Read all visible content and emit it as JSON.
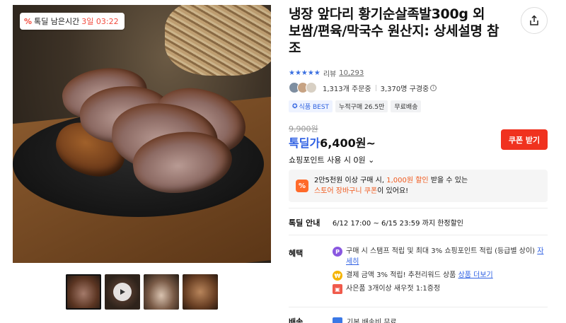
{
  "product": {
    "title": "냉장 앞다리 황기순살족발300g 외 보쌈/편육/막국수 원산지: 상세설명 참조",
    "deal_timer": {
      "label": "톡딜 남은시간",
      "time_left": "3일 03:22"
    },
    "thumbnail_count": 4,
    "active_thumbnail": 1
  },
  "rating": {
    "stars": 5,
    "review_label": "리뷰",
    "review_count": "10,293"
  },
  "buyers": {
    "orders": "1,313개 주문중",
    "subscribers": "3,370명 구경중"
  },
  "tags": [
    "식품 BEST",
    "누적구매 26.5만",
    "무료배송"
  ],
  "price": {
    "original": "9,900원",
    "deal_label": "톡딜가",
    "deal_price": "6,400원~",
    "coupon_button": "쿠폰 받기",
    "points_label": "쇼핑포인트 사용 시",
    "points_value": "0원"
  },
  "promo": {
    "icon": "%",
    "line1_a": "2만5천원 이상 구매 시, ",
    "line1_hl": "1,000원 할인",
    "line1_b": " 받을 수 있는",
    "line2_hl": "스토어 장바구니 쿠폰",
    "line2_b": "이 있어요!"
  },
  "deal_info": {
    "label": "톡딜 안내",
    "period": "6/12 17:00 ~ 6/15 23:59 까지 한정할인"
  },
  "benefits": {
    "label": "혜택",
    "items": [
      {
        "icon": "point-icon",
        "text": "구매 시 스탬프 적립 및 최대 3% 쇼핑포인트 적립 (등급별 상이)",
        "link": "자세히"
      },
      {
        "icon": "coin-icon",
        "text": "결제 금액 3% 적립! 추천리워드 상품",
        "link": "상품 더보기"
      },
      {
        "icon": "gift-icon",
        "text": "사은품 3개이상 새우젓 1:1증정",
        "link": ""
      }
    ]
  },
  "shipping": {
    "label": "배송",
    "text": "기본 배송비 무료"
  },
  "colors": {
    "accent": "#2d5fe3",
    "coupon": "#f0321f",
    "promo_highlight": "#f05a1e"
  }
}
